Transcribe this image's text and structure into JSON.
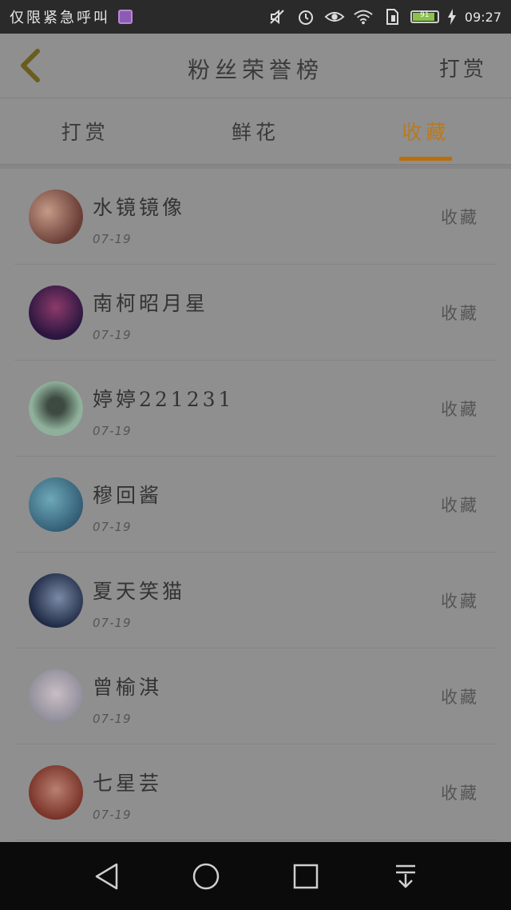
{
  "status_bar": {
    "carrier_text": "仅限紧急呼叫",
    "time": "09:27",
    "battery_level": "91",
    "icons": [
      "image-notification-icon",
      "mute-icon",
      "alarm-icon",
      "eye-icon",
      "wifi-icon",
      "sim-icon",
      "battery-icon",
      "charging-icon"
    ]
  },
  "header": {
    "title": "粉丝荣誉榜",
    "reward_label": "打赏",
    "back_icon": "chevron-left-icon"
  },
  "tabs": [
    {
      "label": "打赏",
      "active": false
    },
    {
      "label": "鲜花",
      "active": false
    },
    {
      "label": "收藏",
      "active": true
    }
  ],
  "rows": [
    {
      "name": "水镜镜像",
      "date": "07-19",
      "action": "收藏",
      "avatar_color": "#8a5a52"
    },
    {
      "name": "南柯昭月星",
      "date": "07-19",
      "action": "收藏",
      "avatar_color": "#4a2a55"
    },
    {
      "name": "婷婷221231",
      "date": "07-19",
      "action": "收藏",
      "avatar_color": "#7f9f8a"
    },
    {
      "name": "穆回酱",
      "date": "07-19",
      "action": "收藏",
      "avatar_color": "#4c7a8c"
    },
    {
      "name": "夏天笑猫",
      "date": "07-19",
      "action": "收藏",
      "avatar_color": "#3a4a66"
    },
    {
      "name": "曾榆淇",
      "date": "07-19",
      "action": "收藏",
      "avatar_color": "#a8a0a8"
    },
    {
      "name": "七星芸",
      "date": "07-19",
      "action": "收藏",
      "avatar_color": "#8a4a3e"
    }
  ],
  "colors": {
    "accent": "#b86f0a",
    "overlay_bg": "#8f8f8f",
    "navbar_bg": "#0b0b0b"
  }
}
